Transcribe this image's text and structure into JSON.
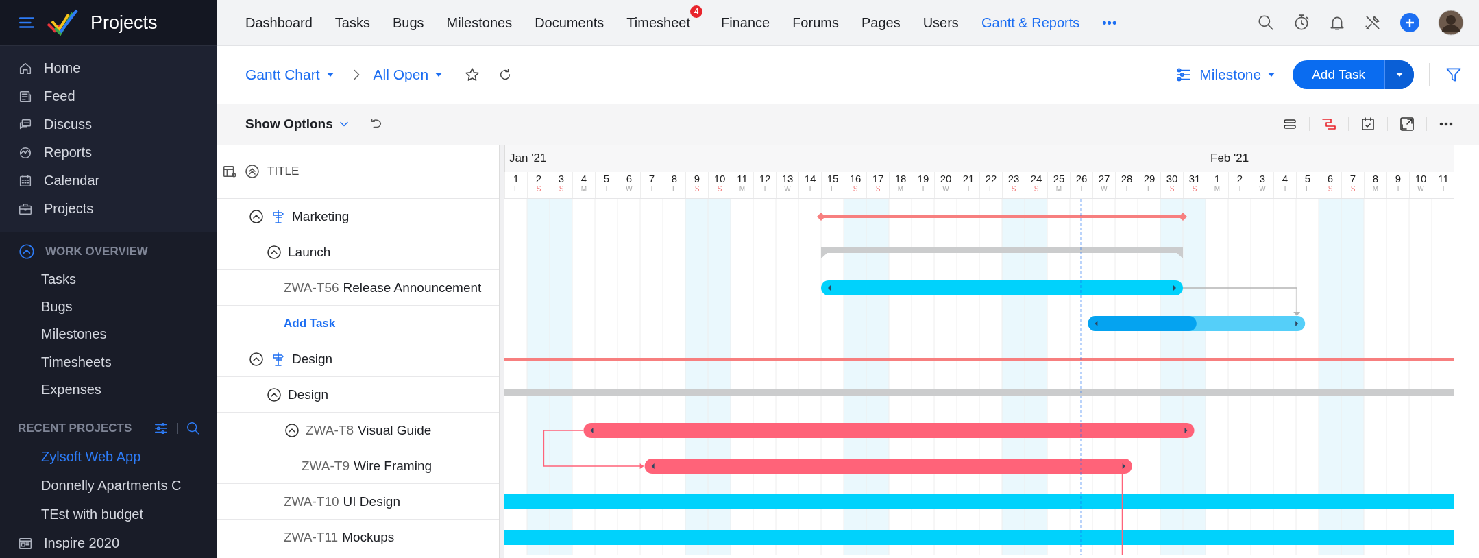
{
  "sidebar": {
    "app_title": "Projects",
    "nav": [
      {
        "label": "Home",
        "selected": false
      },
      {
        "label": "Feed",
        "selected": false
      },
      {
        "label": "Discuss",
        "selected": false
      },
      {
        "label": "Reports",
        "selected": false
      },
      {
        "label": "Calendar",
        "selected": false
      },
      {
        "label": "Projects",
        "selected": false
      }
    ],
    "work_overview": {
      "title": "WORK OVERVIEW",
      "expanded": true,
      "items": [
        {
          "label": "Tasks",
          "selected": false
        },
        {
          "label": "Bugs",
          "selected": false
        },
        {
          "label": "Milestones",
          "selected": false
        },
        {
          "label": "Timesheets",
          "selected": false
        },
        {
          "label": "Expenses",
          "selected": false
        }
      ]
    },
    "recent_projects": {
      "title": "RECENT PROJECTS",
      "items": [
        {
          "label": "Zylsoft Web App",
          "selected": true,
          "kind": "project"
        },
        {
          "label": "Donnelly Apartments C",
          "selected": false,
          "kind": "project"
        },
        {
          "label": "TEst with budget",
          "selected": false,
          "kind": "project"
        },
        {
          "label": "Inspire 2020",
          "selected": false,
          "kind": "portal"
        }
      ]
    }
  },
  "top_nav": {
    "tabs": [
      {
        "label": "Dashboard",
        "selected": false
      },
      {
        "label": "Tasks",
        "selected": false
      },
      {
        "label": "Bugs",
        "selected": false
      },
      {
        "label": "Milestones",
        "selected": false
      },
      {
        "label": "Documents",
        "selected": false
      },
      {
        "label": "Timesheet",
        "selected": false,
        "badge": "4"
      },
      {
        "label": "Finance",
        "selected": false
      },
      {
        "label": "Forums",
        "selected": false
      },
      {
        "label": "Pages",
        "selected": false
      },
      {
        "label": "Users",
        "selected": false
      },
      {
        "label": "Gantt & Reports",
        "selected": true
      }
    ],
    "more": "•••"
  },
  "view_bar": {
    "view": "Gantt Chart",
    "filter": "All Open",
    "favorite": false,
    "group_by": "Milestone",
    "add_button": "Add Task"
  },
  "options_bar": {
    "label": "Show Options"
  },
  "title_column": {
    "label": "TITLE"
  },
  "timeline": {
    "days": [
      {
        "month": "Jan '21",
        "date": "1",
        "weekday": "F",
        "weekend": false
      },
      {
        "date": "2",
        "weekday": "S",
        "weekend": true
      },
      {
        "date": "3",
        "weekday": "S",
        "weekend": true
      },
      {
        "date": "4",
        "weekday": "M",
        "weekend": false
      },
      {
        "date": "5",
        "weekday": "T",
        "weekend": false
      },
      {
        "date": "6",
        "weekday": "W",
        "weekend": false
      },
      {
        "date": "7",
        "weekday": "T",
        "weekend": false
      },
      {
        "date": "8",
        "weekday": "F",
        "weekend": false
      },
      {
        "date": "9",
        "weekday": "S",
        "weekend": true
      },
      {
        "date": "10",
        "weekday": "S",
        "weekend": true
      },
      {
        "date": "11",
        "weekday": "M",
        "weekend": false
      },
      {
        "date": "12",
        "weekday": "T",
        "weekend": false
      },
      {
        "date": "13",
        "weekday": "W",
        "weekend": false
      },
      {
        "date": "14",
        "weekday": "T",
        "weekend": false
      },
      {
        "date": "15",
        "weekday": "F",
        "weekend": false
      },
      {
        "date": "16",
        "weekday": "S",
        "weekend": true
      },
      {
        "date": "17",
        "weekday": "S",
        "weekend": true
      },
      {
        "date": "18",
        "weekday": "M",
        "weekend": false
      },
      {
        "date": "19",
        "weekday": "T",
        "weekend": false
      },
      {
        "date": "20",
        "weekday": "W",
        "weekend": false
      },
      {
        "date": "21",
        "weekday": "T",
        "weekend": false
      },
      {
        "date": "22",
        "weekday": "F",
        "weekend": false
      },
      {
        "date": "23",
        "weekday": "S",
        "weekend": true
      },
      {
        "date": "24",
        "weekday": "S",
        "weekend": true
      },
      {
        "date": "25",
        "weekday": "M",
        "weekend": false
      },
      {
        "date": "26",
        "weekday": "T",
        "weekend": false
      },
      {
        "date": "27",
        "weekday": "W",
        "weekend": false
      },
      {
        "date": "28",
        "weekday": "T",
        "weekend": false
      },
      {
        "date": "29",
        "weekday": "F",
        "weekend": false
      },
      {
        "date": "30",
        "weekday": "S",
        "weekend": true
      },
      {
        "date": "31",
        "weekday": "S",
        "weekend": true
      },
      {
        "month": "Feb '21",
        "date": "1",
        "weekday": "M",
        "weekend": false
      },
      {
        "date": "2",
        "weekday": "T",
        "weekend": false
      },
      {
        "date": "3",
        "weekday": "W",
        "weekend": false
      },
      {
        "date": "4",
        "weekday": "T",
        "weekend": false
      },
      {
        "date": "5",
        "weekday": "F",
        "weekend": false
      },
      {
        "date": "6",
        "weekday": "S",
        "weekend": true
      },
      {
        "date": "7",
        "weekday": "S",
        "weekend": true
      },
      {
        "date": "8",
        "weekday": "M",
        "weekend": false
      },
      {
        "date": "9",
        "weekday": "T",
        "weekend": false
      },
      {
        "date": "10",
        "weekday": "W",
        "weekend": false
      },
      {
        "date": "11",
        "weekday": "T",
        "weekend": false
      }
    ]
  },
  "rows": [
    {
      "kind": "milestone",
      "title": "Marketing",
      "expanded": true,
      "bar": {
        "kind": "milestone"
      },
      "children": [
        {
          "title": "Launch",
          "expanded": true,
          "bar": {
            "kind": "tasklist"
          },
          "children": [
            {
              "key": "ZWA-T56",
              "title": "Release Announcement",
              "bar": {
                "kind": "task",
                "color": "#00d2fc"
              }
            },
            {
              "kind": "add",
              "title": "Add Task",
              "finish_link": true,
              "bar": {
                "kind": "task",
                "color": "#55cff9",
                "level": 0.5
              }
            }
          ]
        }
      ]
    },
    {
      "kind": "milestone",
      "title": "Design",
      "expanded": true,
      "bar": {
        "kind": "milestone",
        "spans_view": true
      },
      "children": [
        {
          "title": "Design",
          "expanded": true,
          "bar": {
            "kind": "tasklist",
            "spans_view": true
          },
          "children": [
            {
              "key": "ZWA-T8",
              "title": "Visual Guide",
              "expanded": true,
              "bar": {
                "kind": "task",
                "color": "#ff6379"
              },
              "children": [
                {
                  "key": "ZWA-T9",
                  "title": "Wire Framing",
                  "start_link": true,
                  "successor_below": true,
                  "bar": {
                    "kind": "task",
                    "color": "#ff6379"
                  }
                }
              ]
            },
            {
              "key": "ZWA-T10",
              "title": "UI Design",
              "bar": {
                "kind": "task",
                "spans_view": true,
                "color": "#00d2fc"
              }
            },
            {
              "key": "ZWA-T11",
              "title": "Mockups",
              "bar": {
                "kind": "task",
                "spans_view": true,
                "color": "#00d2fc"
              }
            }
          ]
        }
      ]
    }
  ]
}
